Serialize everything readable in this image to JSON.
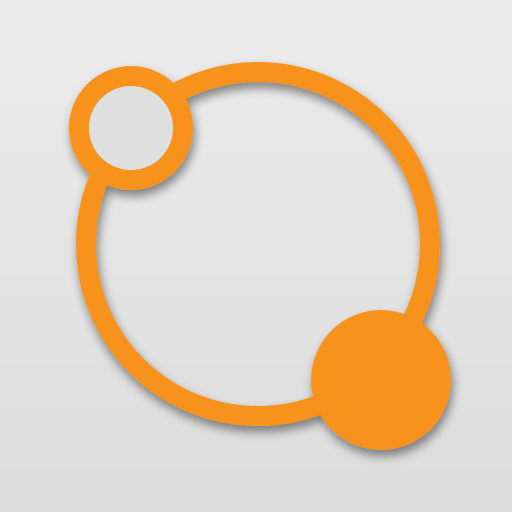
{
  "icon": {
    "name": "orbit-logo-icon",
    "colors": {
      "accent": "#F7931E",
      "accent_shade": "#E8861A",
      "background_top": "#ECECEC",
      "background_bottom": "#DCDCDC",
      "shadow": "#8A8A8A"
    }
  }
}
